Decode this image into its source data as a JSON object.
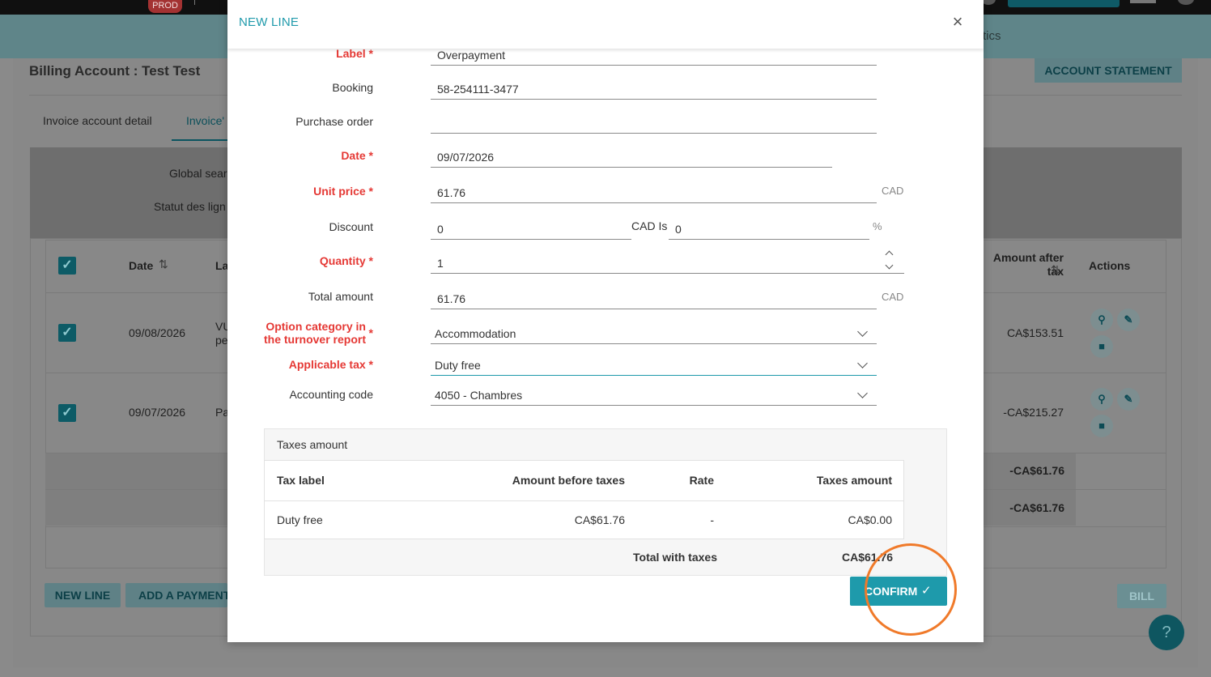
{
  "background": {
    "env_badge": "PROD",
    "nav_partial": "tics",
    "billing_account_title": "Billing Account : Test Test",
    "account_statement_button": "ACCOUNT STATEMENT",
    "tabs": [
      "Invoice account detail",
      "Invoice'"
    ],
    "filter_labels": [
      "Global sear",
      "Statut des lign"
    ],
    "table": {
      "headers": {
        "date": "Date",
        "label_partial": "La",
        "amount_after_tax": "Amount after tax",
        "actions": "Actions"
      },
      "sort_icon": "⇅",
      "rows": [
        {
          "date": "09/08/2026",
          "label_partial": "VU pe",
          "amount": "CA$153.51"
        },
        {
          "date": "09/07/2026",
          "label_partial": "Pa",
          "amount": "-CA$215.27"
        }
      ],
      "summary_rows": [
        "-CA$61.76",
        "-CA$61.76"
      ]
    },
    "buttons": {
      "new_line": "NEW LINE",
      "add_payment": "ADD A PAYMENT",
      "bill": "BILL",
      "help": "?"
    },
    "checkbox_glyph": "✓"
  },
  "modal": {
    "title": "NEW LINE",
    "close_icon": "×",
    "fields": {
      "label": {
        "label": "Label *",
        "value": "Overpayment"
      },
      "booking": {
        "label": "Booking",
        "value": "58-254111-3477"
      },
      "purchase_order": {
        "label": "Purchase order",
        "value": ""
      },
      "date": {
        "label": "Date *",
        "value": "09/07/2026"
      },
      "unit_price": {
        "label": "Unit price *",
        "value": "61.76",
        "suffix": "CAD"
      },
      "discount": {
        "label": "Discount",
        "value": "0",
        "mid_label": "CAD Is",
        "percent_value": "0",
        "suffix": "%"
      },
      "quantity": {
        "label": "Quantity *",
        "value": "1"
      },
      "total_amount": {
        "label": "Total amount",
        "value": "61.76",
        "suffix": "CAD"
      },
      "option_category": {
        "label_line1": "Option category in",
        "label_line2": "the turnover report",
        "required_mark": "*",
        "value": "Accommodation"
      },
      "applicable_tax": {
        "label": "Applicable tax *",
        "value": "Duty free"
      },
      "accounting_code": {
        "label": "Accounting code",
        "value": "4050 - Chambres"
      }
    },
    "taxes": {
      "title": "Taxes amount",
      "headers": [
        "Tax label",
        "Amount before taxes",
        "Rate",
        "Taxes amount"
      ],
      "rows": [
        {
          "tax_label": "Duty free",
          "amount_before": "CA$61.76",
          "rate": "-",
          "taxes_amount": "CA$0.00"
        }
      ],
      "total_label": "Total with taxes",
      "total_value": "CA$61.76"
    },
    "confirm_button": "CONFIRM",
    "confirm_icon": "✓"
  },
  "colors": {
    "accent": "#1e9aab",
    "required": "#e53935",
    "highlight": "#f07a2a"
  }
}
